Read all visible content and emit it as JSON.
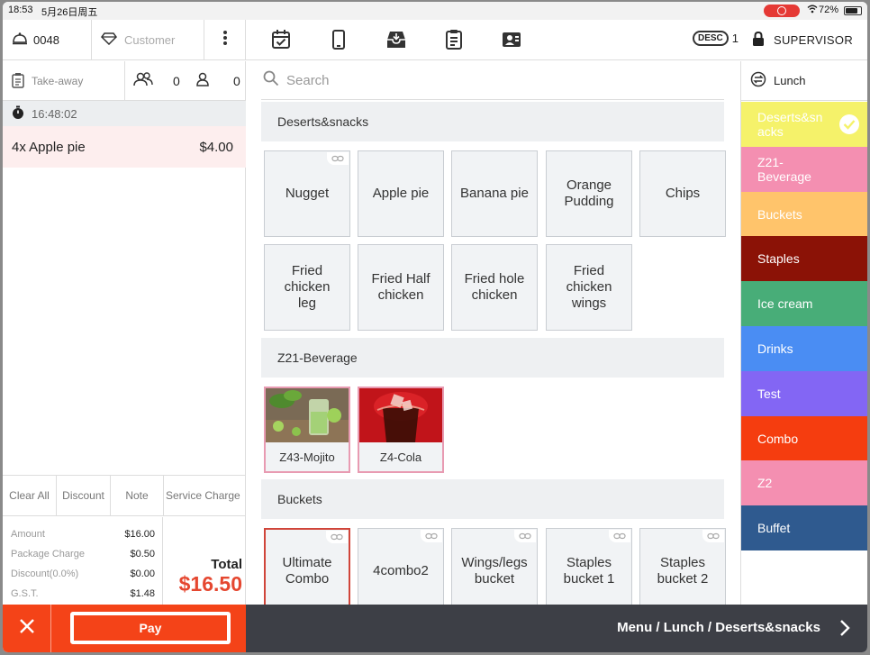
{
  "status": {
    "time": "18:53",
    "date": "5月26日周五",
    "battery": "72%"
  },
  "topbar": {
    "order_no": "0048",
    "customer_placeholder": "Customer",
    "desc_badge": "DESC",
    "desc_count": "1",
    "role": "SUPERVISOR",
    "icons": [
      "calendar-check-icon",
      "tablet-icon",
      "inbox-download-icon",
      "clipboard-list-icon",
      "user-card-icon"
    ]
  },
  "order": {
    "type": "Take-away",
    "guests": "0",
    "staff": "0",
    "timer": "16:48:02",
    "items": [
      {
        "label": "4x Apple pie",
        "price": "$4.00"
      }
    ]
  },
  "actions": {
    "clear_all": "Clear All",
    "discount": "Discount",
    "note": "Note",
    "service_charge": "Service Charge"
  },
  "summary": {
    "rows": [
      {
        "label": "Amount",
        "value": "$16.00"
      },
      {
        "label": "Package Charge",
        "value": "$0.50"
      },
      {
        "label": "Discount(0.0%)",
        "value": "$0.00"
      },
      {
        "label": "G.S.T.",
        "value": "$1.48"
      }
    ],
    "total_label": "Total",
    "total_value": "$16.50"
  },
  "pay": {
    "label": "Pay"
  },
  "search": {
    "placeholder": "Search"
  },
  "sections": [
    {
      "title": "Deserts&snacks",
      "items": [
        "Nugget",
        "Apple  pie",
        "Banana  pie",
        "Orange\nPudding",
        "Chips",
        "Fried\nchicken\nleg",
        "Fried  Half\nchicken",
        "Fried  hole\nchicken",
        "Fried\nchicken\nwings"
      ]
    },
    {
      "title": "Z21-Beverage",
      "items": [
        "Z43-Mojito",
        "Z4-Cola"
      ]
    },
    {
      "title": "Buckets",
      "items": [
        "Ultimate\nCombo",
        "4combo2",
        "Wings/legs\nbucket",
        "Staples\nbucket  1",
        "Staples\nbucket  2"
      ]
    }
  ],
  "menu": {
    "name": "Lunch"
  },
  "categories": [
    {
      "label": "Deserts&sn\nacks",
      "color": "#f5f26a",
      "selected": true
    },
    {
      "label": "Z21-\nBeverage",
      "color": "#f48fb1"
    },
    {
      "label": "Buckets",
      "color": "#ffc46b"
    },
    {
      "label": "Staples",
      "color": "#8b1206"
    },
    {
      "label": "Ice cream",
      "color": "#48ad78"
    },
    {
      "label": "Drinks",
      "color": "#4a8df3"
    },
    {
      "label": "Test",
      "color": "#8366f4"
    },
    {
      "label": "Combo",
      "color": "#f53d0f"
    },
    {
      "label": "Z2",
      "color": "#f48fb1"
    },
    {
      "label": "Buffet",
      "color": "#2f5a8f"
    }
  ],
  "breadcrumb": "Menu / Lunch / Deserts&snacks"
}
